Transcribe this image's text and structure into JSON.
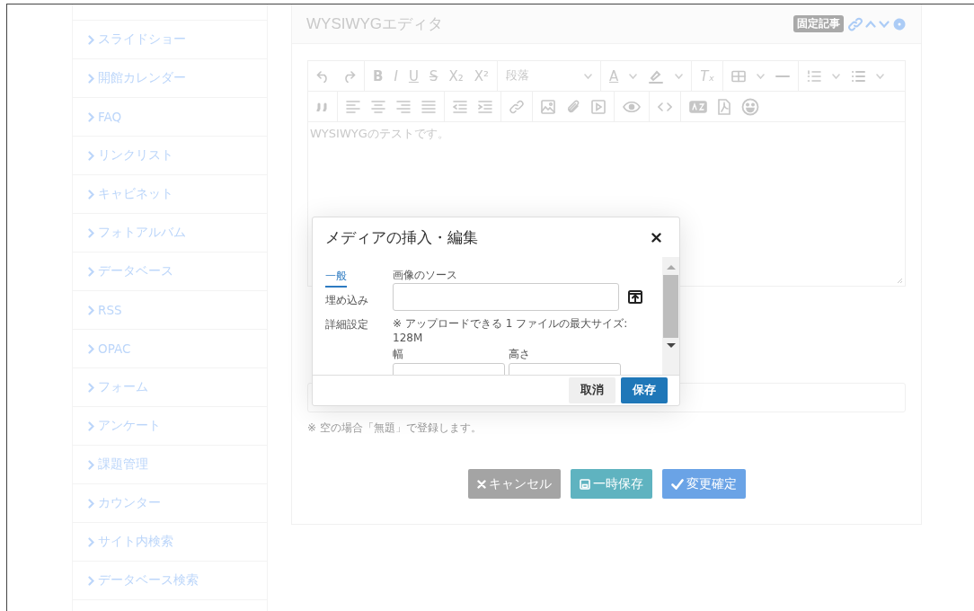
{
  "sidebar": {
    "items": [
      {
        "label": "スライドショー"
      },
      {
        "label": "開館カレンダー"
      },
      {
        "label": "FAQ"
      },
      {
        "label": "リンクリスト"
      },
      {
        "label": "キャビネット"
      },
      {
        "label": "フォトアルバム"
      },
      {
        "label": "データベース"
      },
      {
        "label": "RSS"
      },
      {
        "label": "OPAC"
      },
      {
        "label": "フォーム"
      },
      {
        "label": "アンケート"
      },
      {
        "label": "課題管理"
      },
      {
        "label": "カウンター"
      },
      {
        "label": "サイト内検索"
      },
      {
        "label": "データベース検索"
      }
    ]
  },
  "frame": {
    "title": "WYSIWYGエディタ",
    "badge": "固定記事"
  },
  "editor": {
    "text_buttons": [
      "B",
      "I",
      "U",
      "S",
      "X₂",
      "X²",
      "A",
      "Tₓ"
    ],
    "format_select": "段落",
    "content": "WYSIWYGのテストです。"
  },
  "form": {
    "hint": "※ 空の場合「無題」で登録します。",
    "buttons": [
      {
        "kind": "cancel",
        "label": "キャンセル"
      },
      {
        "kind": "draft",
        "label": "一時保存"
      },
      {
        "kind": "confirm",
        "label": "変更確定"
      }
    ]
  },
  "dialog": {
    "title": "メディアの挿入・編集",
    "tabs": [
      {
        "label": "一般",
        "selected": true
      },
      {
        "label": "埋め込み",
        "selected": false
      },
      {
        "label": "詳細設定",
        "selected": false
      }
    ],
    "source_label": "画像のソース",
    "note": "※ アップロードできる 1 ファイルの最大サイズ: 128M",
    "width_label": "幅",
    "height_label": "高さ",
    "buttons": [
      {
        "kind": "secondary",
        "label": "取消"
      },
      {
        "kind": "primary",
        "label": "保存"
      }
    ]
  }
}
